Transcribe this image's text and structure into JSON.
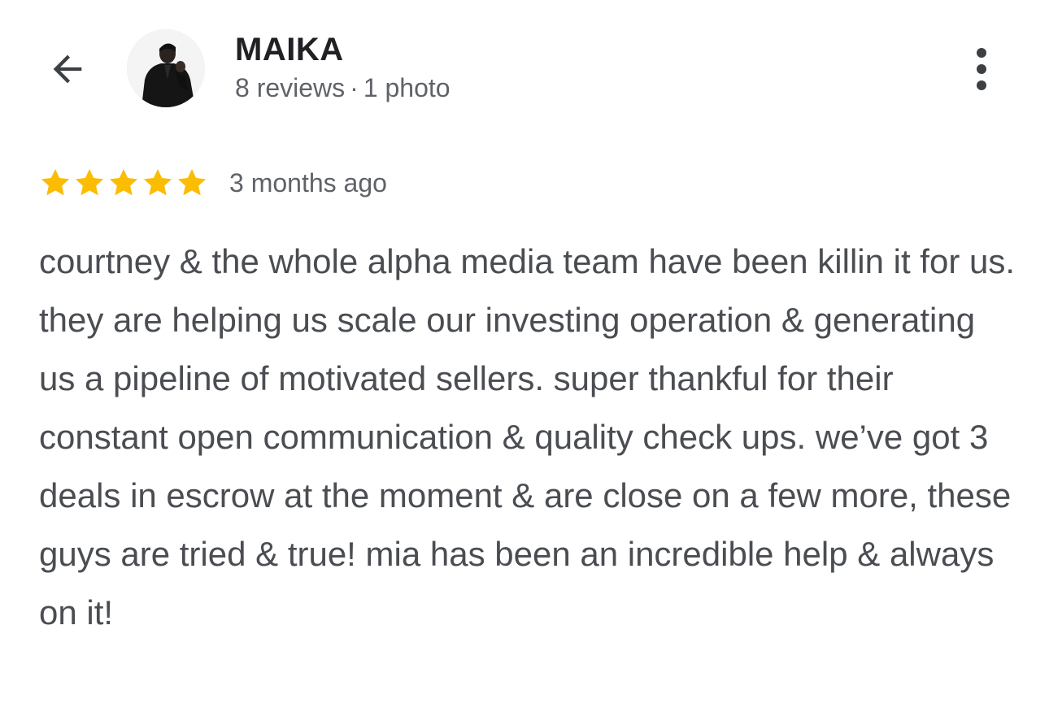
{
  "header": {
    "back_icon": "arrow-left-icon",
    "reviewer_name": "MAIKA",
    "reviews_count": "8 reviews",
    "separator": "·",
    "photos_count": "1 photo",
    "more_icon": "more-vertical-icon"
  },
  "review": {
    "rating": 5,
    "rating_max": 5,
    "star_color": "#fbbc04",
    "time_ago": "3 months ago",
    "text": "courtney & the whole alpha media team have been killin it for us. they are helping us scale our investing operation & generating us a pipeline of motivated sellers. super thankful for their constant open communication & quality check ups. we’ve got 3 deals in escrow at the moment & are close on a few more, these guys are tried & true! mia has been an incredible help & always on it!"
  }
}
